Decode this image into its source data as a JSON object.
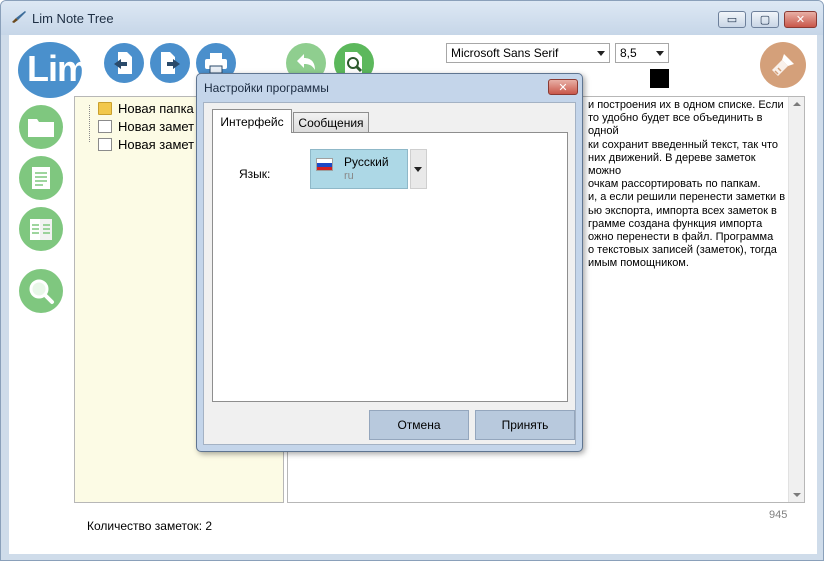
{
  "window": {
    "title": "Lim Note Tree",
    "controls": {
      "minimize": "▭",
      "maximize": "▢",
      "close": "✕"
    }
  },
  "toolbar": {
    "logo_text": "Lim",
    "font_family": "Microsoft Sans Serif",
    "font_size": "8,5",
    "text_color": "#000000",
    "icons": [
      "import-icon",
      "export-icon",
      "print-icon",
      "undo-icon",
      "search-note-icon",
      "brush-icon"
    ]
  },
  "sidebar": {
    "icons": [
      "folder-icon",
      "note-icon",
      "notes-icon",
      "search-icon"
    ]
  },
  "tree": {
    "items": [
      {
        "label": "Новая папка",
        "type": "folder"
      },
      {
        "label": "Новая замет",
        "type": "note"
      },
      {
        "label": "Новая замет",
        "type": "note"
      }
    ]
  },
  "editor": {
    "lines": [
      "и построения их в одном списке. Если",
      "то удобно будет все объединить в одной",
      "ки сохранит введенный текст, так что",
      "них движений. В дереве заметок можно",
      "очкам рассортировать по папкам.",
      "и, а если решили перенести заметки в",
      "ью экспорта, импорта всех заметок в",
      "грамме создана функция импорта",
      "ожно перенести в файл. Программа",
      "о текстовых записей (заметок), тогда",
      "имым помощником."
    ],
    "char_count": "945"
  },
  "status": {
    "note_count": "Количество заметок: 2"
  },
  "dialog": {
    "title": "Настройки программы",
    "close": "✕",
    "tabs": [
      {
        "label": "Интерфейс",
        "active": true
      },
      {
        "label": "Сообщения",
        "active": false
      }
    ],
    "language_label": "Язык:",
    "language": {
      "name": "Русский",
      "code": "ru"
    },
    "cancel_label": "Отмена",
    "ok_label": "Принять"
  }
}
